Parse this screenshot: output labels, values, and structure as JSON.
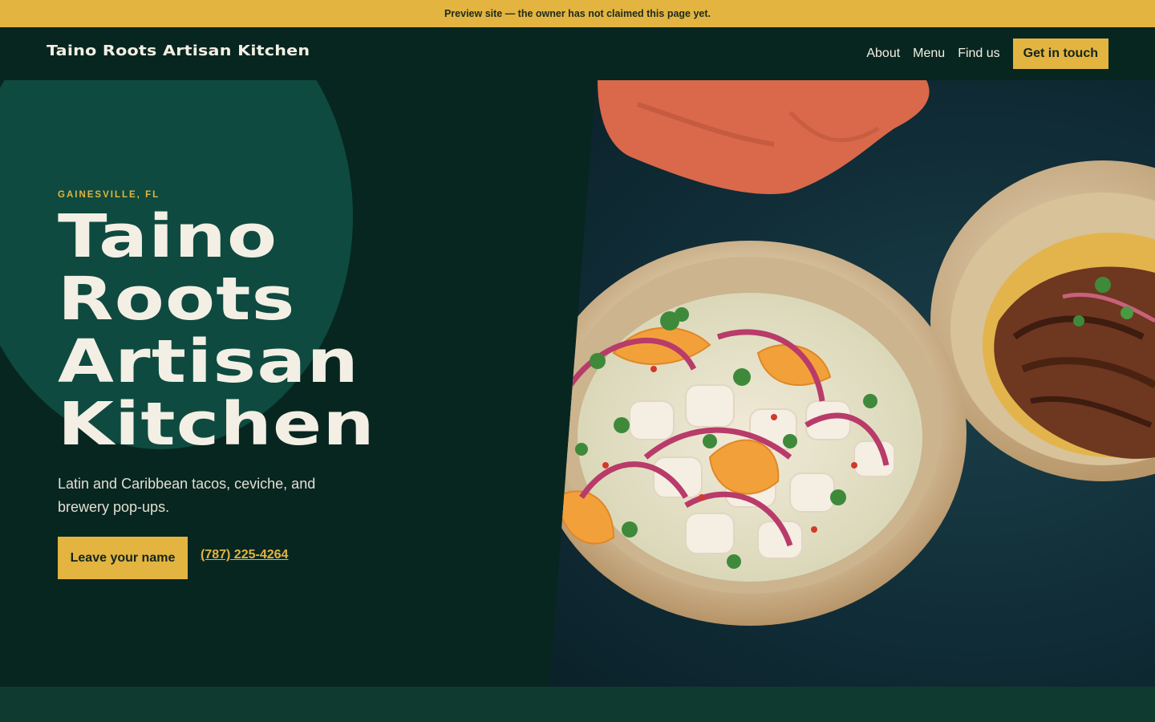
{
  "banner": {
    "text": "Preview site — the owner has not claimed this page yet."
  },
  "header": {
    "brand": "Taino Roots Artisan Kitchen",
    "nav": {
      "about": "About",
      "menu": "Menu",
      "find": "Find us",
      "cta": "Get in touch"
    }
  },
  "hero": {
    "eyebrow": "GAINESVILLE, FL",
    "title_lines": [
      "Taino",
      "Roots",
      "Artisan",
      "Kitchen"
    ],
    "subtitle": "Latin and Caribbean tacos, ceviche, and brewery pop-ups.",
    "primary_button": "Leave your name",
    "phone": "(787) 225-4264",
    "image_alt": "Ceviche bowl with citrus, red onion and cilantro beside a plate of grilled meat tacos"
  },
  "colors": {
    "accent": "#e3b440",
    "dark_green": "#072620",
    "header_green": "#082620",
    "circle_green": "#0e4a3f",
    "band_green": "#0f3a30",
    "cream": "#f3efe4"
  }
}
